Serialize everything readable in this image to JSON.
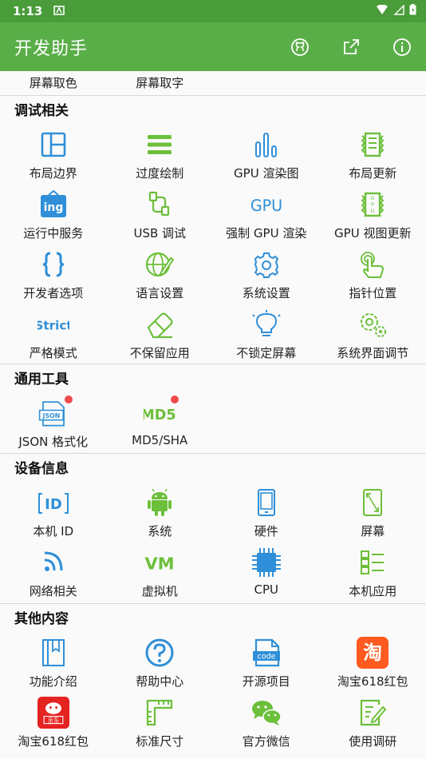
{
  "status_bar": {
    "time": "1:13"
  },
  "app_bar": {
    "title": "开发助手"
  },
  "top_row": [
    "屏幕取色",
    "屏幕取字"
  ],
  "sections": {
    "debug": {
      "title": "调试相关",
      "rows": [
        [
          "布局边界",
          "过度绘制",
          "GPU 渲染图",
          "布局更新"
        ],
        [
          "运行中服务",
          "USB 调试",
          "强制 GPU 渲染",
          "GPU 视图更新"
        ],
        [
          "开发者选项",
          "语言设置",
          "系统设置",
          "指针位置"
        ],
        [
          "严格模式",
          "不保留应用",
          "不锁定屏幕",
          "系统界面调节"
        ]
      ]
    },
    "tools": {
      "title": "通用工具",
      "rows": [
        [
          "JSON 格式化",
          "MD5/SHA"
        ]
      ]
    },
    "device": {
      "title": "设备信息",
      "rows": [
        [
          "本机 ID",
          "系统",
          "硬件",
          "屏幕"
        ],
        [
          "网络相关",
          "虚拟机",
          "CPU",
          "本机应用"
        ]
      ]
    },
    "other": {
      "title": "其他内容",
      "rows": [
        [
          "功能介绍",
          "帮助中心",
          "开源项目",
          "淘宝618红包"
        ],
        [
          "淘宝618红包",
          "标准尺寸",
          "官方微信",
          "使用调研"
        ]
      ]
    }
  },
  "icon_text": {
    "gpu": "GPU",
    "strict": "Strict",
    "json": "JSON",
    "md5": "MD5",
    "vm": "VM",
    "id": "ID",
    "code": "code",
    "taobao": "淘",
    "jd": "京东",
    "ing": "ing"
  },
  "colors": {
    "app_bar": "#5aae48",
    "status_bar": "#4a9b3a",
    "blue": "#2f8fd8",
    "green": "#6cbf3a",
    "badge": "#f24a4a"
  }
}
